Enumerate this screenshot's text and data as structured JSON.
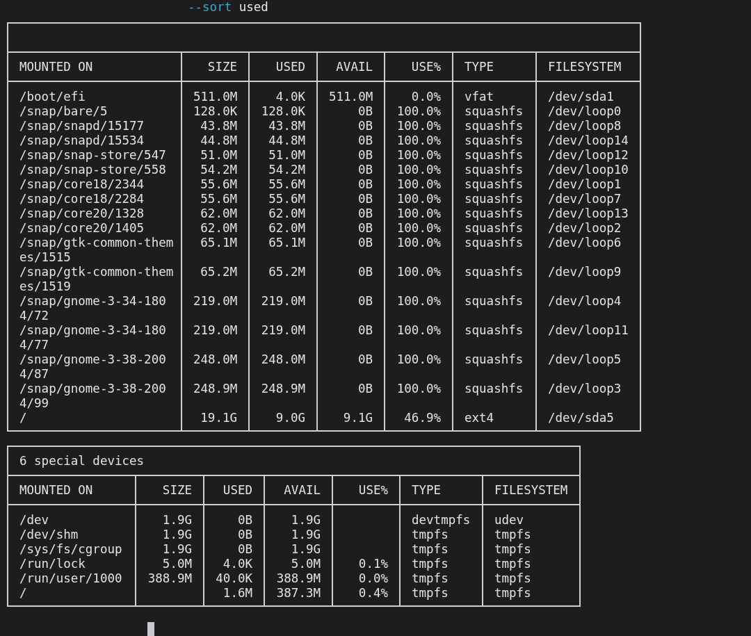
{
  "command": {
    "flag": "--sort",
    "argument": "used"
  },
  "tables": [
    {
      "columns": [
        "MOUNTED ON",
        "SIZE",
        "USED",
        "AVAIL",
        "USE%",
        "TYPE",
        "FILESYSTEM"
      ],
      "rows": [
        [
          "/boot/efi",
          "511.0M",
          "4.0K",
          "511.0M",
          "0.0%",
          "vfat",
          "/dev/sda1"
        ],
        [
          "/snap/bare/5",
          "128.0K",
          "128.0K",
          "0B",
          "100.0%",
          "squashfs",
          "/dev/loop0"
        ],
        [
          "/snap/snapd/15177",
          "43.8M",
          "43.8M",
          "0B",
          "100.0%",
          "squashfs",
          "/dev/loop8"
        ],
        [
          "/snap/snapd/15534",
          "44.8M",
          "44.8M",
          "0B",
          "100.0%",
          "squashfs",
          "/dev/loop14"
        ],
        [
          "/snap/snap-store/547",
          "51.0M",
          "51.0M",
          "0B",
          "100.0%",
          "squashfs",
          "/dev/loop12"
        ],
        [
          "/snap/snap-store/558",
          "54.2M",
          "54.2M",
          "0B",
          "100.0%",
          "squashfs",
          "/dev/loop10"
        ],
        [
          "/snap/core18/2344",
          "55.6M",
          "55.6M",
          "0B",
          "100.0%",
          "squashfs",
          "/dev/loop1"
        ],
        [
          "/snap/core18/2284",
          "55.6M",
          "55.6M",
          "0B",
          "100.0%",
          "squashfs",
          "/dev/loop7"
        ],
        [
          "/snap/core20/1328",
          "62.0M",
          "62.0M",
          "0B",
          "100.0%",
          "squashfs",
          "/dev/loop13"
        ],
        [
          "/snap/core20/1405",
          "62.0M",
          "62.0M",
          "0B",
          "100.0%",
          "squashfs",
          "/dev/loop2"
        ],
        [
          "/snap/gtk-common-themes/1515",
          "65.1M",
          "65.1M",
          "0B",
          "100.0%",
          "squashfs",
          "/dev/loop6"
        ],
        [
          "/snap/gtk-common-themes/1519",
          "65.2M",
          "65.2M",
          "0B",
          "100.0%",
          "squashfs",
          "/dev/loop9"
        ],
        [
          "/snap/gnome-3-34-1804/72",
          "219.0M",
          "219.0M",
          "0B",
          "100.0%",
          "squashfs",
          "/dev/loop4"
        ],
        [
          "/snap/gnome-3-34-1804/77",
          "219.0M",
          "219.0M",
          "0B",
          "100.0%",
          "squashfs",
          "/dev/loop11"
        ],
        [
          "/snap/gnome-3-38-2004/87",
          "248.0M",
          "248.0M",
          "0B",
          "100.0%",
          "squashfs",
          "/dev/loop5"
        ],
        [
          "/snap/gnome-3-38-2004/99",
          "248.9M",
          "248.9M",
          "0B",
          "100.0%",
          "squashfs",
          "/dev/loop3"
        ],
        [
          "/",
          "19.1G",
          "9.0G",
          "9.1G",
          "46.9%",
          "ext4",
          "/dev/sda5"
        ]
      ]
    },
    {
      "title": "6 special devices",
      "columns": [
        "MOUNTED ON",
        "SIZE",
        "USED",
        "AVAIL",
        "USE%",
        "TYPE",
        "FILESYSTEM"
      ],
      "rows": [
        [
          "/dev",
          "1.9G",
          "0B",
          "1.9G",
          null,
          "devtmpfs",
          "udev"
        ],
        [
          "/dev/shm",
          "1.9G",
          "0B",
          "1.9G",
          null,
          "tmpfs",
          "tmpfs"
        ],
        [
          "/sys/fs/cgroup",
          "1.9G",
          "0B",
          "1.9G",
          null,
          "tmpfs",
          "tmpfs"
        ],
        [
          "/run/lock",
          "5.0M",
          "4.0K",
          "5.0M",
          "0.1%",
          "tmpfs",
          "tmpfs"
        ],
        [
          "/run/user/1000",
          "388.9M",
          "40.0K",
          "388.9M",
          "0.0%",
          "tmpfs",
          "tmpfs"
        ],
        [
          "/",
          null,
          "1.6M",
          "387.3M",
          "0.4%",
          "tmpfs",
          "tmpfs"
        ]
      ]
    }
  ]
}
